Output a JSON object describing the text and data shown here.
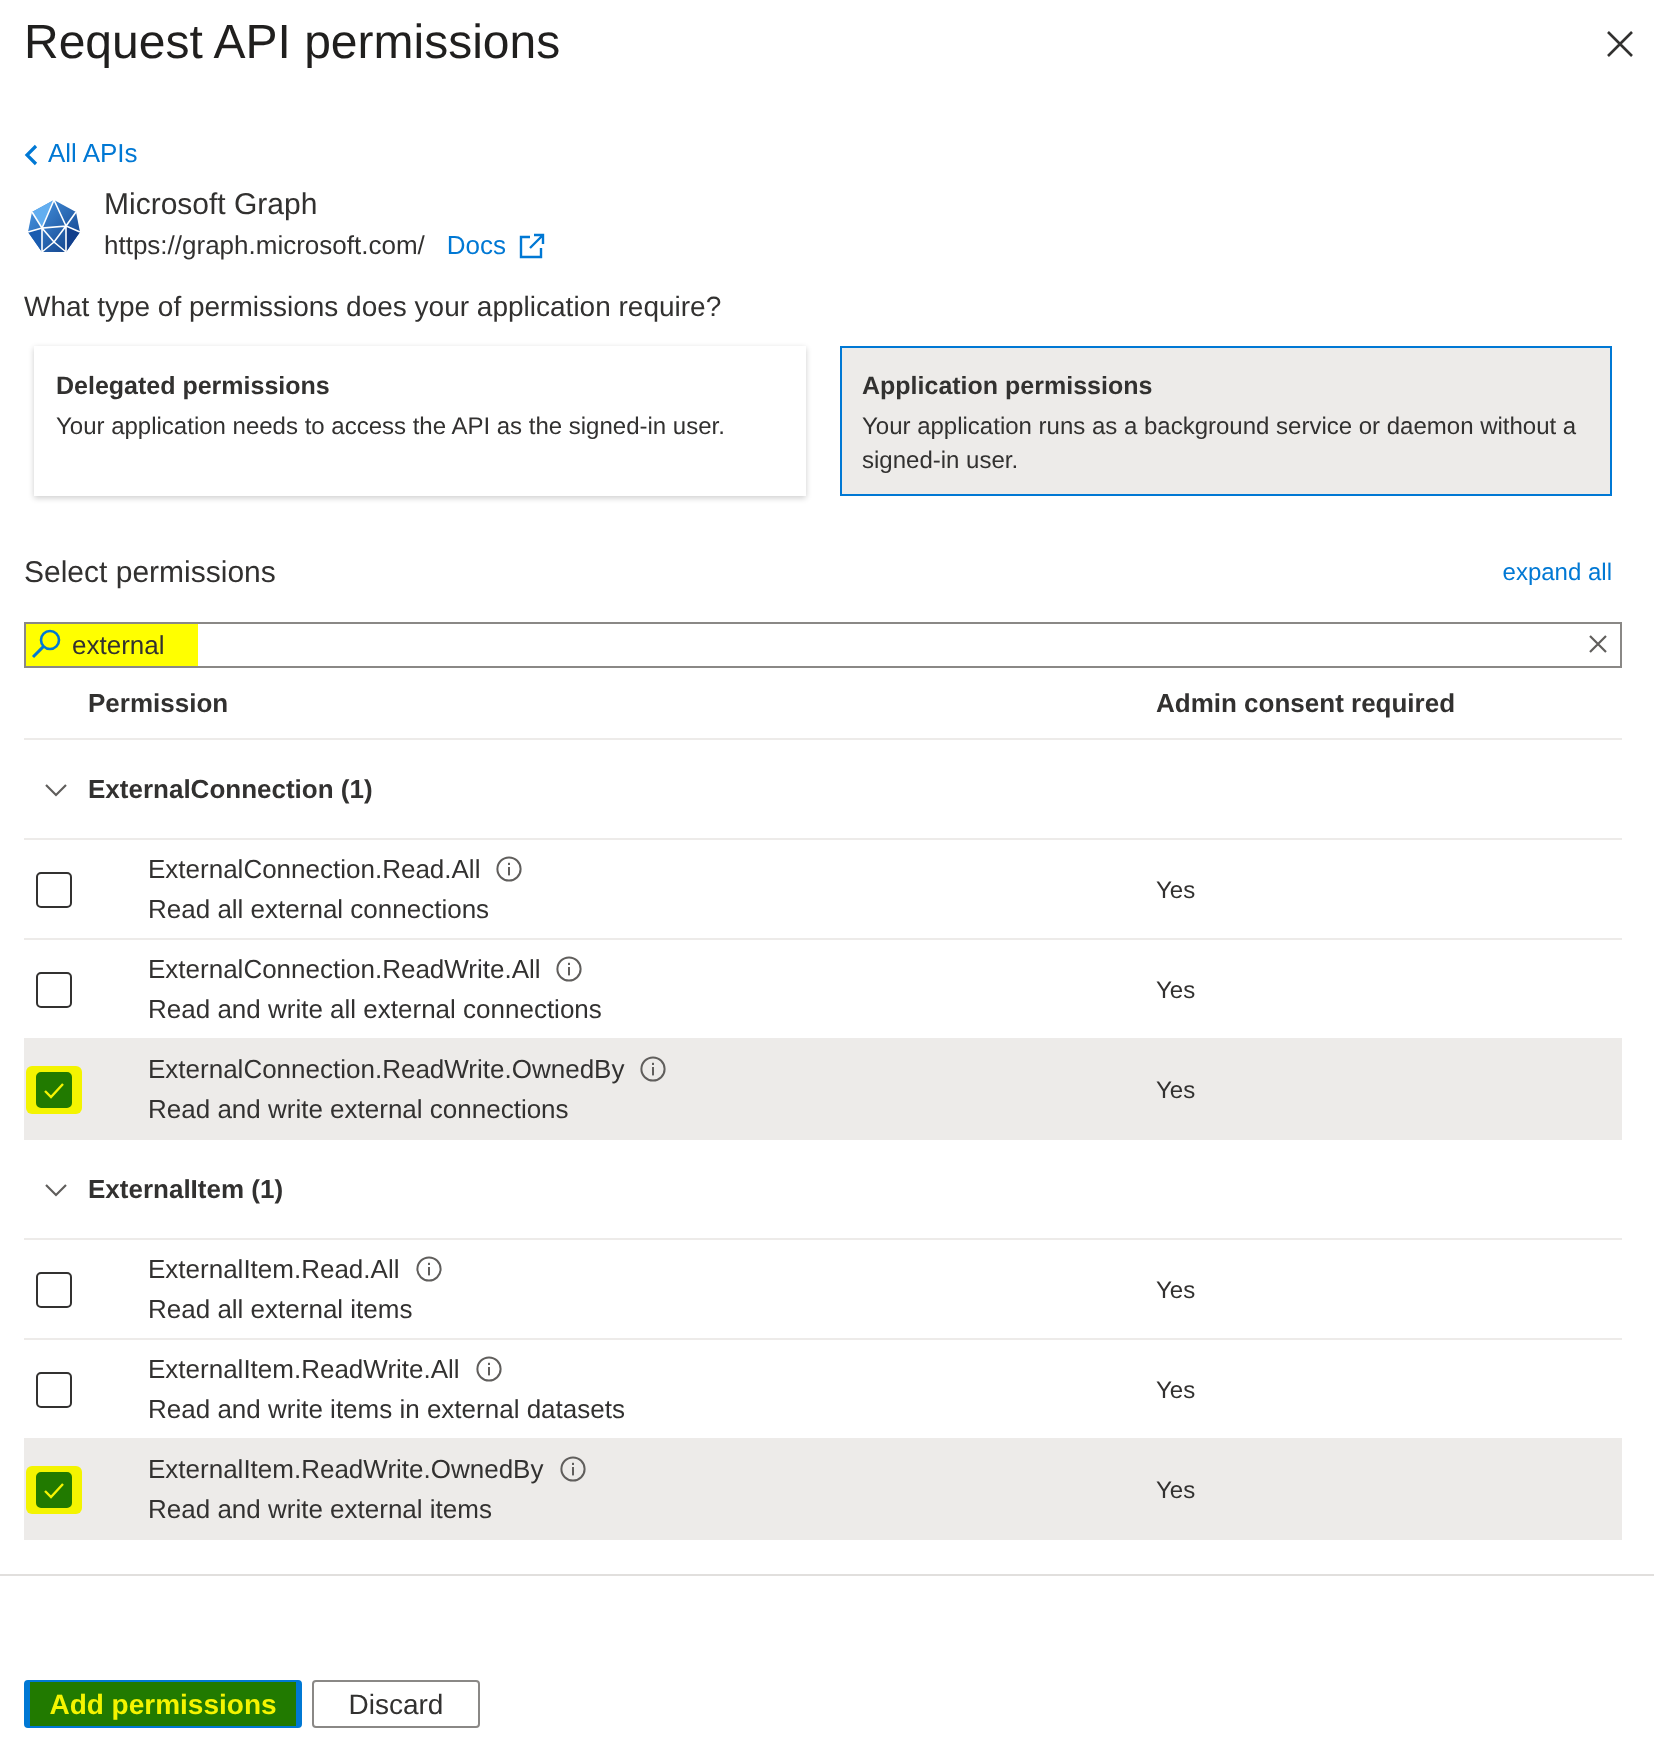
{
  "panel": {
    "title": "Request API permissions"
  },
  "back_link": "All APIs",
  "api": {
    "name": "Microsoft Graph",
    "url": "https://graph.microsoft.com/",
    "docs_link": "Docs"
  },
  "question": "What type of permissions does your application require?",
  "permission_types": [
    {
      "title": "Delegated permissions",
      "description": "Your application needs to access the API as the signed-in user.",
      "selected": false
    },
    {
      "title": "Application permissions",
      "description": "Your application runs as a background service or daemon without a signed-in user.",
      "selected": true
    }
  ],
  "select_heading": "Select permissions",
  "expand_all": "expand all",
  "search": {
    "value": "external",
    "highlighted": true
  },
  "table": {
    "columns": [
      "Permission",
      "Admin consent required"
    ],
    "groups": [
      {
        "name": "ExternalConnection (1)",
        "expanded": true,
        "permissions": [
          {
            "name": "ExternalConnection.Read.All",
            "description": "Read all external connections",
            "admin_consent": "Yes",
            "checked": false,
            "highlighted": false
          },
          {
            "name": "ExternalConnection.ReadWrite.All",
            "description": "Read and write all external connections",
            "admin_consent": "Yes",
            "checked": false,
            "highlighted": false
          },
          {
            "name": "ExternalConnection.ReadWrite.OwnedBy",
            "description": "Read and write external connections",
            "admin_consent": "Yes",
            "checked": true,
            "highlighted": true
          }
        ]
      },
      {
        "name": "ExternalItem (1)",
        "expanded": true,
        "permissions": [
          {
            "name": "ExternalItem.Read.All",
            "description": "Read all external items",
            "admin_consent": "Yes",
            "checked": false,
            "highlighted": false
          },
          {
            "name": "ExternalItem.ReadWrite.All",
            "description": "Read and write items in external datasets",
            "admin_consent": "Yes",
            "checked": false,
            "highlighted": false
          },
          {
            "name": "ExternalItem.ReadWrite.OwnedBy",
            "description": "Read and write external items",
            "admin_consent": "Yes",
            "checked": true,
            "highlighted": true
          }
        ]
      }
    ]
  },
  "buttons": [
    {
      "label": "Add permissions",
      "kind": "primary",
      "highlighted": true
    },
    {
      "label": "Discard",
      "kind": "secondary",
      "highlighted": false
    }
  ]
}
